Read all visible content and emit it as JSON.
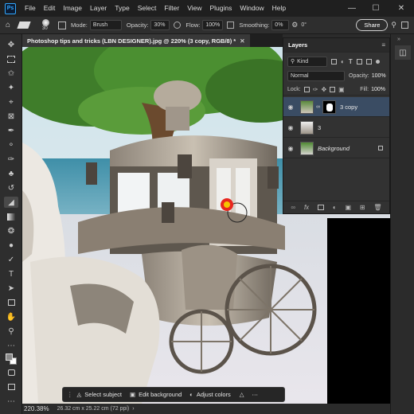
{
  "app": {
    "logo": "Ps"
  },
  "menu": [
    "File",
    "Edit",
    "Image",
    "Layer",
    "Type",
    "Select",
    "Filter",
    "View",
    "Plugins",
    "Window",
    "Help"
  ],
  "options": {
    "brush_size": "30",
    "mode_label": "Mode:",
    "mode_value": "Brush",
    "opacity_label": "Opacity:",
    "opacity_value": "30%",
    "flow_label": "Flow:",
    "flow_value": "100%",
    "smoothing_label": "Smoothing:",
    "smoothing_value": "0%",
    "angle_value": "0°",
    "share_label": "Share"
  },
  "document": {
    "tab_title": "Photoshop tips and tricks (LBN DESIGNER).jpg @ 220% (3 copy, RGB/8) *"
  },
  "layers_panel": {
    "title": "Layers",
    "filter_kind": "Kind",
    "blend_mode": "Normal",
    "opacity_label": "Opacity:",
    "opacity_value": "100%",
    "lock_label": "Lock:",
    "fill_label": "Fill:",
    "fill_value": "100%",
    "layers": [
      {
        "name": "3 copy",
        "selected": true
      },
      {
        "name": "3",
        "selected": false
      },
      {
        "name": "Background",
        "selected": false
      }
    ]
  },
  "status": {
    "zoom": "220.38%",
    "doc_size": "26.32 cm x 25.22 cm (72 ppi)"
  },
  "context_bar": {
    "select_subject": "Select subject",
    "edit_background": "Edit background",
    "adjust_colors": "Adjust colors"
  },
  "colors": {
    "accent": "#31a8ff",
    "cursor_ring": "#e8261e",
    "cursor_center": "#f5c400",
    "selected_layer": "#3a4c63"
  }
}
